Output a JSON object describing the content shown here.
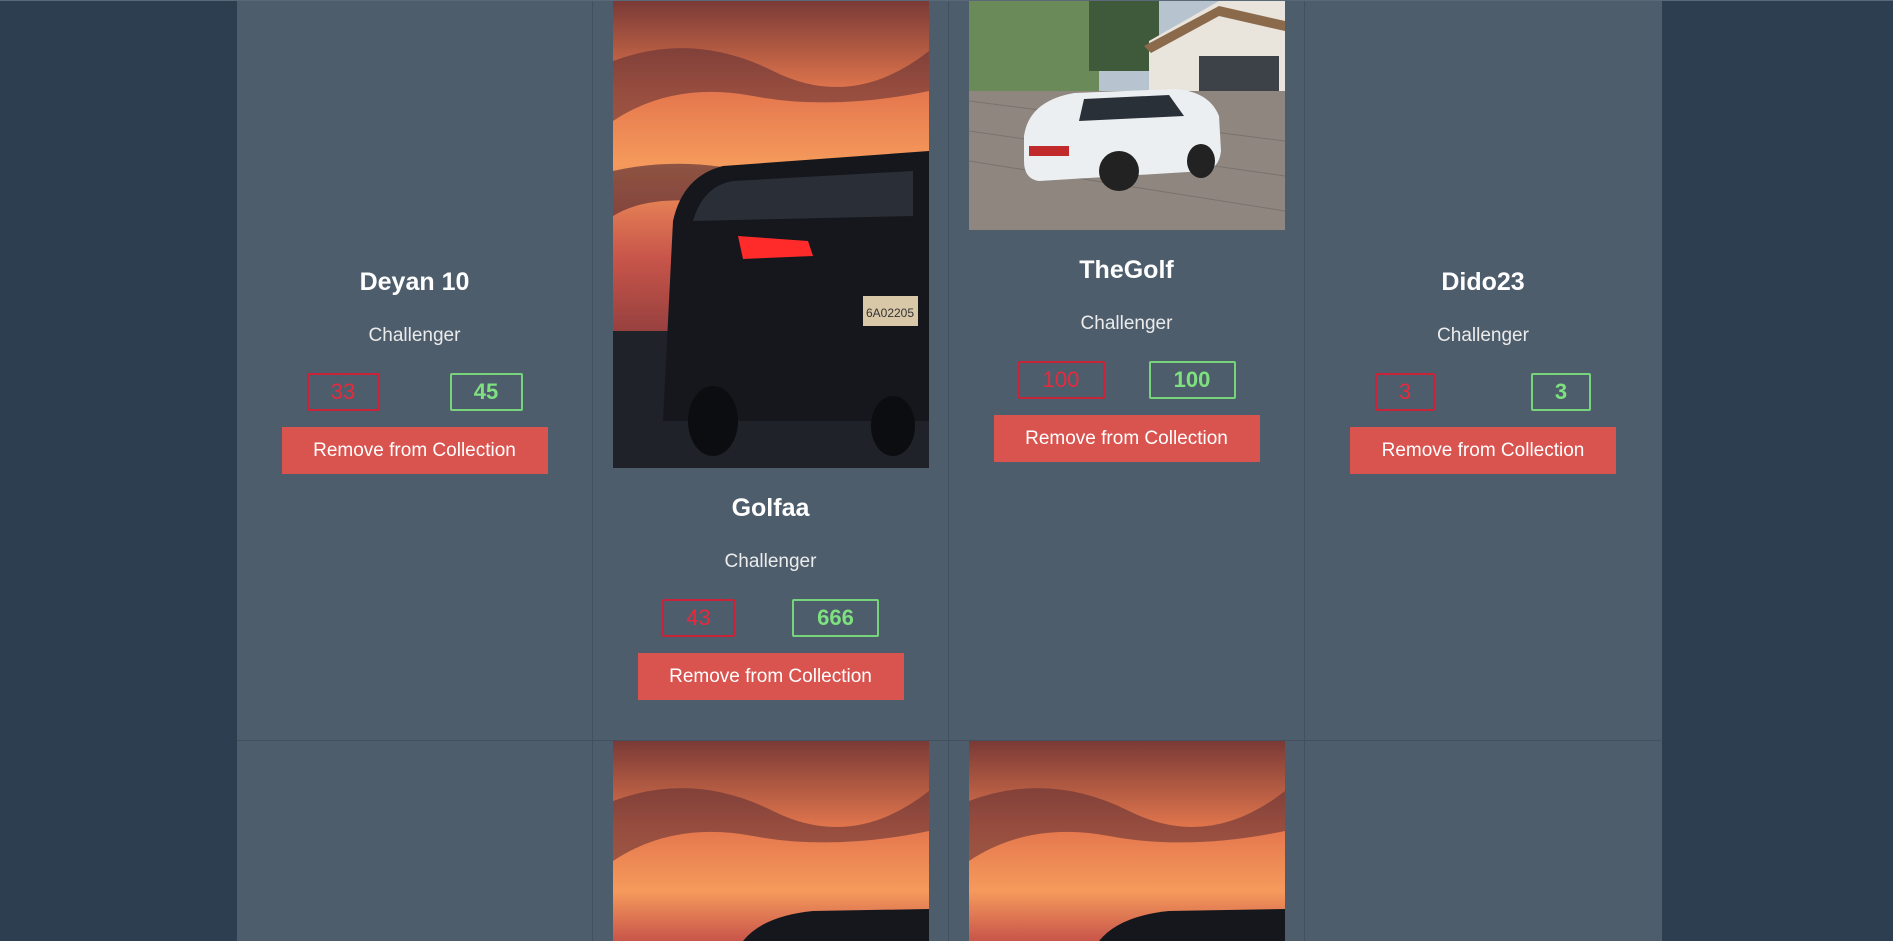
{
  "cards": [
    {
      "name": "Deyan 10",
      "role": "Challenger",
      "red": "33",
      "green": "45",
      "button": "Remove from Collection",
      "image": "none"
    },
    {
      "name": "Golfaa",
      "role": "Challenger",
      "red": "43",
      "green": "666",
      "button": "Remove from Collection",
      "image": "sunset-suv-rear-photo"
    },
    {
      "name": "TheGolf",
      "role": "Challenger",
      "red": "100",
      "green": "100",
      "button": "Remove from Collection",
      "image": "white-hatchback-driveway-photo"
    },
    {
      "name": "Dido23",
      "role": "Challenger",
      "red": "3",
      "green": "3",
      "button": "Remove from Collection",
      "image": "none"
    }
  ],
  "row2_images": [
    "none",
    "sunset-suv-rear-photo",
    "sunset-suv-rear-photo",
    "none"
  ],
  "colors": {
    "page_background": "#2c3e50",
    "card_background": "#4e5d6c",
    "remove_button": "#d9534f",
    "loss_stat": "#e52a3e",
    "win_stat": "#7ee07e"
  }
}
